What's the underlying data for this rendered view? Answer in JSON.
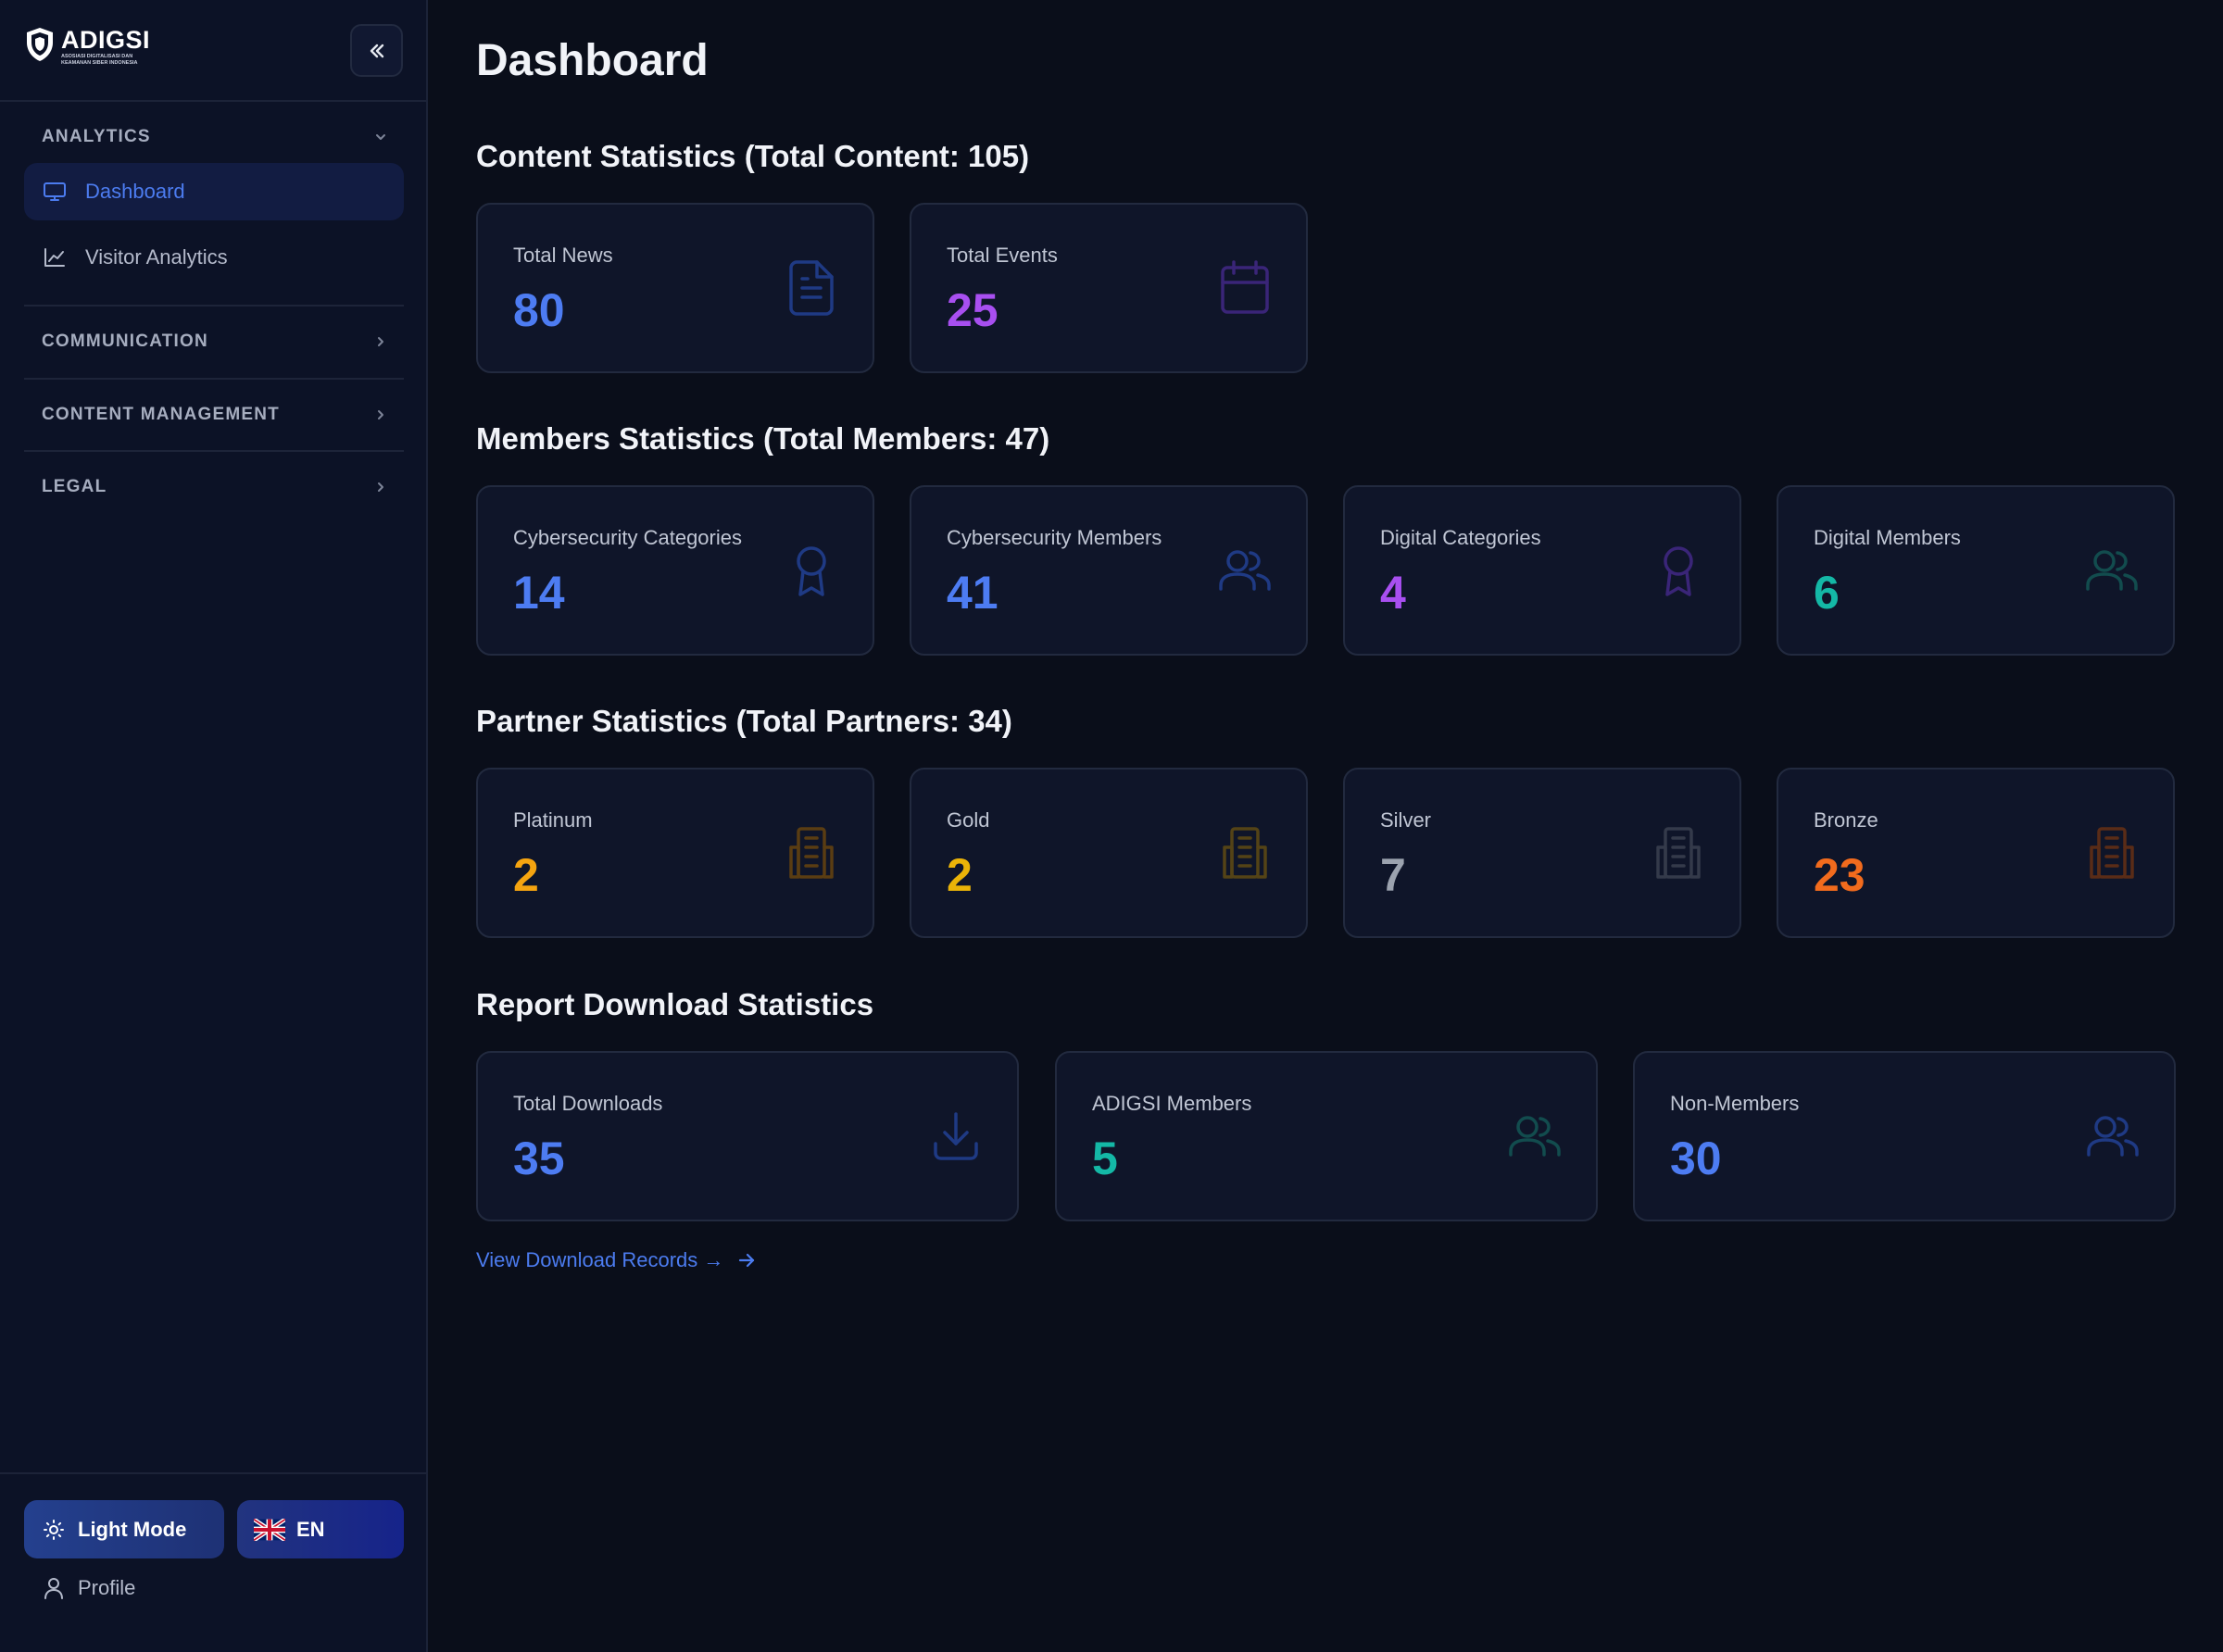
{
  "brand": {
    "name": "ADIGSI",
    "subtitle_line1": "ASOSIASI DIGITALISASI DAN",
    "subtitle_line2": "KEAMANAN SIBER INDONESIA"
  },
  "sidebar": {
    "sections": [
      {
        "label": "ANALYTICS",
        "expanded": true,
        "items": [
          {
            "label": "Dashboard",
            "icon": "monitor-icon",
            "active": true
          },
          {
            "label": "Visitor Analytics",
            "icon": "line-chart-icon",
            "active": false
          }
        ]
      },
      {
        "label": "COMMUNICATION",
        "expanded": false
      },
      {
        "label": "CONTENT MANAGEMENT",
        "expanded": false
      },
      {
        "label": "LEGAL",
        "expanded": false
      }
    ],
    "footer": {
      "mode_label": "Light Mode",
      "lang_label": "EN",
      "profile_label": "Profile"
    }
  },
  "main": {
    "title": "Dashboard",
    "content_stats": {
      "title": "Content Statistics (Total Content: 105)",
      "cards": [
        {
          "label": "Total News",
          "value": "80",
          "color": "#4d7cf2",
          "icon": "document-icon"
        },
        {
          "label": "Total Events",
          "value": "25",
          "color": "#a84ff0",
          "icon": "calendar-icon"
        }
      ]
    },
    "member_stats": {
      "title": "Members Statistics (Total Members: 47)",
      "cards": [
        {
          "label": "Cybersecurity Categories",
          "value": "14",
          "color": "#4d7cf2",
          "icon": "award-icon"
        },
        {
          "label": "Cybersecurity Members",
          "value": "41",
          "color": "#4d7cf2",
          "icon": "users-icon"
        },
        {
          "label": "Digital Categories",
          "value": "4",
          "color": "#a84ff0",
          "icon": "award-icon"
        },
        {
          "label": "Digital Members",
          "value": "6",
          "color": "#14b8a6",
          "icon": "users-icon"
        }
      ]
    },
    "partner_stats": {
      "title": "Partner Statistics (Total Partners: 34)",
      "cards": [
        {
          "label": "Platinum",
          "value": "2",
          "color": "#f5a410",
          "icon": "building-icon"
        },
        {
          "label": "Gold",
          "value": "2",
          "color": "#eab308",
          "icon": "building-icon"
        },
        {
          "label": "Silver",
          "value": "7",
          "color": "#9ca3af",
          "icon": "building-icon"
        },
        {
          "label": "Bronze",
          "value": "23",
          "color": "#f26b1d",
          "icon": "building-icon"
        }
      ]
    },
    "report_stats": {
      "title": "Report Download Statistics",
      "cards": [
        {
          "label": "Total Downloads",
          "value": "35",
          "color": "#4d7cf2",
          "icon": "download-icon"
        },
        {
          "label": "ADIGSI Members",
          "value": "5",
          "color": "#14b8a6",
          "icon": "users-icon"
        },
        {
          "label": "Non-Members",
          "value": "30",
          "color": "#4d7cf2",
          "icon": "users-icon"
        }
      ],
      "link_label": "View Download Records →"
    }
  }
}
